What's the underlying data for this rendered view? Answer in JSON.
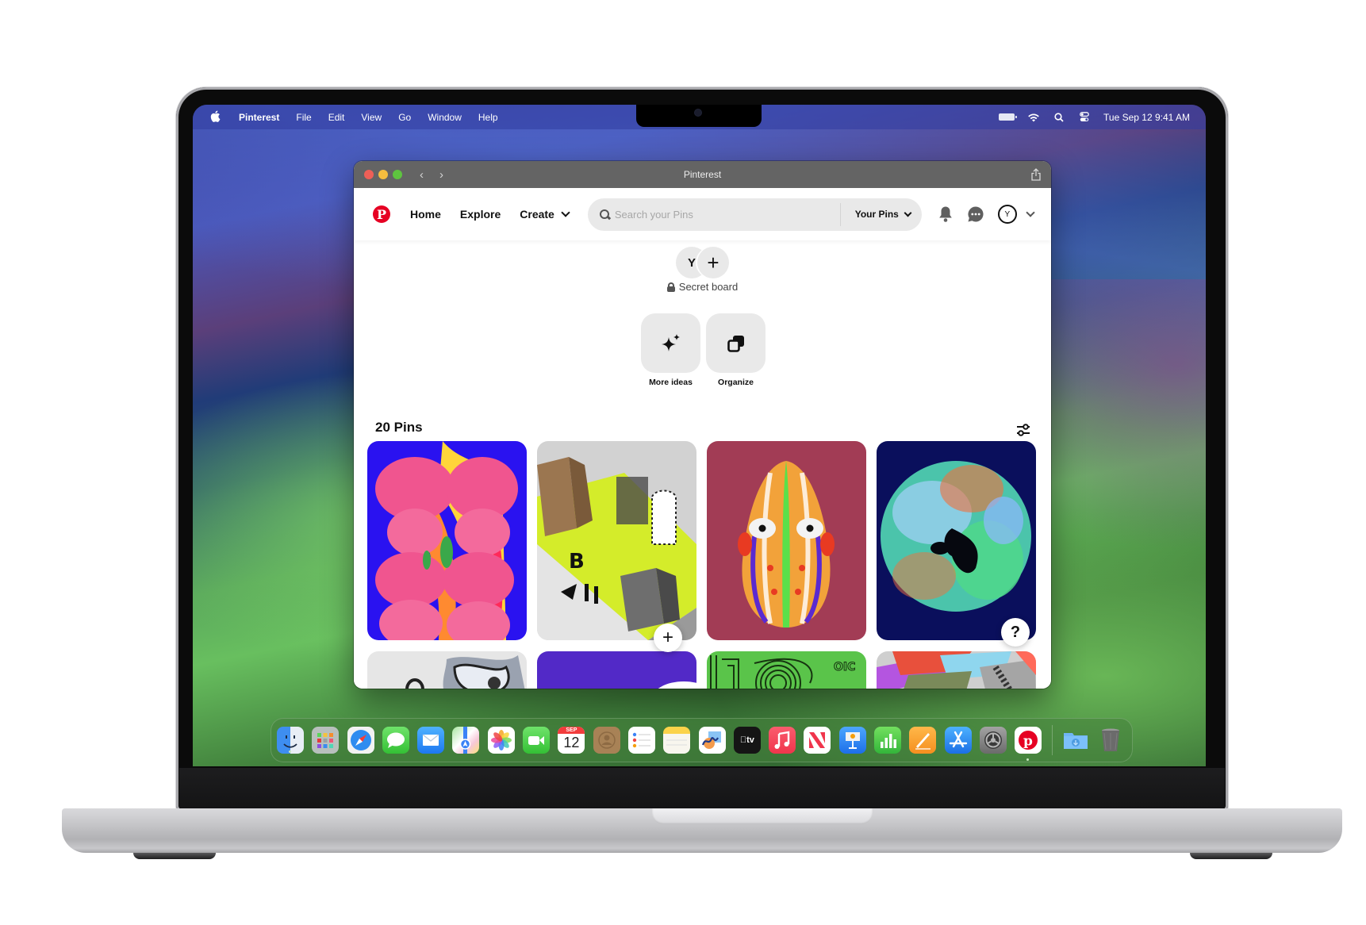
{
  "menubar": {
    "apple_icon": "apple-logo",
    "app_name": "Pinterest",
    "items": [
      "File",
      "Edit",
      "View",
      "Go",
      "Window",
      "Help"
    ],
    "status_icons": [
      "battery-icon",
      "wifi-icon",
      "spotlight-search-icon",
      "control-center-icon"
    ],
    "clock": "Tue Sep 12  9:41 AM"
  },
  "window": {
    "title": "Pinterest",
    "traffic_lights": {
      "close": "#ee5f57",
      "minimize": "#f5bd3f",
      "zoom": "#5ec43f"
    },
    "back_glyph": "‹",
    "forward_glyph": "›"
  },
  "header": {
    "logo": "P",
    "nav": [
      {
        "label": "Home"
      },
      {
        "label": "Explore"
      },
      {
        "label": "Create",
        "has_dropdown": true
      }
    ],
    "search": {
      "placeholder": "Search your Pins",
      "value": "",
      "scope": "Your Pins"
    },
    "avatar_initial": "Y",
    "brand_color": "#e60023"
  },
  "board": {
    "collaborators": [
      "Y"
    ],
    "add_collaborator_glyph": "+",
    "privacy": "Secret board",
    "actions": [
      {
        "label": "More ideas",
        "icon": "sparkle-icon"
      },
      {
        "label": "Organize",
        "icon": "organize-icon"
      }
    ],
    "pin_count_label": "20 Pins",
    "pins": [
      {
        "name": "pink-blobs-on-blue",
        "colors": [
          "#2a12f0",
          "#f0558f",
          "#ffd53a"
        ]
      },
      {
        "name": "3d-isometric-shapes",
        "colors": [
          "#c9c9c9",
          "#d6ee2a",
          "#8a6a48"
        ]
      },
      {
        "name": "striped-face-sculpture",
        "colors": [
          "#a23c55",
          "#f2a23a",
          "#5ae04a"
        ]
      },
      {
        "name": "fluid-color-explosion",
        "colors": [
          "#0a0f5c",
          "#57e4b8",
          "#f2703c"
        ]
      },
      {
        "name": "chrome-liquid-shapes",
        "colors": [
          "#e6e6e6",
          "#222222",
          "#9aa2b0"
        ]
      },
      {
        "name": "purple-blob",
        "colors": [
          "#5229c7",
          "#ffffff"
        ]
      },
      {
        "name": "green-line-art",
        "colors": [
          "#5ac44a",
          "#163410"
        ]
      },
      {
        "name": "paint-strokes",
        "colors": [
          "#b455e0",
          "#8fd6ee",
          "#e8503c"
        ]
      }
    ],
    "add_button_glyph": "+",
    "help_button_glyph": "?"
  },
  "dock": {
    "apps": [
      {
        "name": "Finder",
        "running": true
      },
      {
        "name": "Launchpad"
      },
      {
        "name": "Safari"
      },
      {
        "name": "Messages"
      },
      {
        "name": "Mail"
      },
      {
        "name": "Maps"
      },
      {
        "name": "Photos"
      },
      {
        "name": "FaceTime"
      },
      {
        "name": "Calendar",
        "month": "SEP",
        "day": "12"
      },
      {
        "name": "Contacts"
      },
      {
        "name": "Reminders"
      },
      {
        "name": "Notes"
      },
      {
        "name": "Freeform"
      },
      {
        "name": "TV",
        "label": "tv"
      },
      {
        "name": "Music"
      },
      {
        "name": "News"
      },
      {
        "name": "Keynote"
      },
      {
        "name": "Numbers"
      },
      {
        "name": "Pages"
      },
      {
        "name": "App Store"
      },
      {
        "name": "System Settings"
      },
      {
        "name": "Pinterest",
        "running": true
      }
    ],
    "extras": [
      {
        "name": "Downloads"
      },
      {
        "name": "Trash"
      }
    ]
  }
}
